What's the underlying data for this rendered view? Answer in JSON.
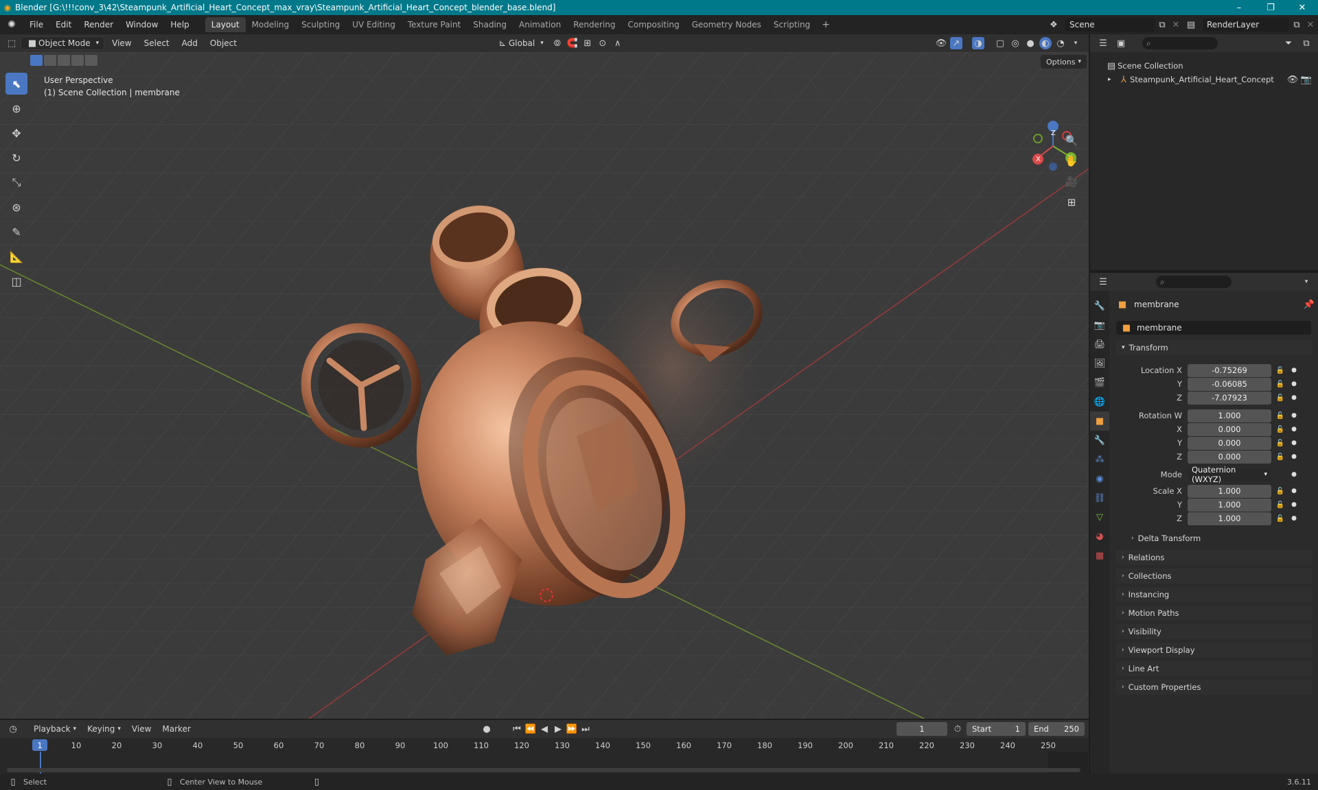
{
  "window": {
    "title": "Blender [G:\\!!!conv_3\\42\\Steampunk_Artificial_Heart_Concept_max_vray\\Steampunk_Artificial_Heart_Concept_blender_base.blend]",
    "min": "–",
    "max": "❐",
    "close": "✕"
  },
  "menu": [
    "File",
    "Edit",
    "Render",
    "Window",
    "Help"
  ],
  "workspaces": [
    "Layout",
    "Modeling",
    "Sculpting",
    "UV Editing",
    "Texture Paint",
    "Shading",
    "Animation",
    "Rendering",
    "Compositing",
    "Geometry Nodes",
    "Scripting"
  ],
  "workspace_active": "Layout",
  "scene": {
    "name": "Scene",
    "render_layer": "RenderLayer"
  },
  "viewport_header": {
    "mode": "Object Mode",
    "menus": [
      "View",
      "Select",
      "Add",
      "Object"
    ],
    "transform_orientation": "Global",
    "options": "Options"
  },
  "viewport": {
    "perspective": "User Perspective",
    "context": "(1) Scene Collection | membrane",
    "gizmo": {
      "x": "X",
      "y": "Y",
      "z": "Z"
    }
  },
  "outliner": {
    "root": "Scene Collection",
    "items": [
      {
        "name": "Steampunk_Artificial_Heart_Concept"
      }
    ]
  },
  "properties": {
    "object_name": "membrane",
    "object_field": "membrane",
    "transform_label": "Transform",
    "location": {
      "label": "Location X",
      "x": "-0.75269",
      "y": "-0.06085",
      "z": "-7.07923"
    },
    "rotation": {
      "label": "Rotation W",
      "w": "1.000",
      "x": "0.000",
      "y": "0.000",
      "z": "0.000"
    },
    "mode": {
      "label": "Mode",
      "value": "Quaternion (WXYZ)"
    },
    "scale": {
      "label": "Scale X",
      "x": "1.000",
      "y": "1.000",
      "z": "1.000"
    },
    "axis_labels": {
      "y": "Y",
      "z": "Z",
      "x": "X"
    },
    "delta_transform": "Delta Transform",
    "sections": [
      "Relations",
      "Collections",
      "Instancing",
      "Motion Paths",
      "Visibility",
      "Viewport Display",
      "Line Art",
      "Custom Properties"
    ]
  },
  "timeline": {
    "menus": [
      "Playback",
      "Keying",
      "View",
      "Marker"
    ],
    "current_frame": "1",
    "start_label": "Start",
    "start": "1",
    "end_label": "End",
    "end": "250",
    "ticks": [
      "10",
      "20",
      "30",
      "40",
      "50",
      "60",
      "70",
      "80",
      "90",
      "100",
      "110",
      "120",
      "130",
      "140",
      "150",
      "160",
      "170",
      "180",
      "190",
      "200",
      "210",
      "220",
      "230",
      "240",
      "250"
    ],
    "playhead": "1"
  },
  "status": {
    "select": "Select",
    "center_view": "Center View to Mouse",
    "version": "3.6.11"
  },
  "colors": {
    "accent": "#4a77c2",
    "titlebar": "#00798a",
    "copper": "#b5714f"
  }
}
